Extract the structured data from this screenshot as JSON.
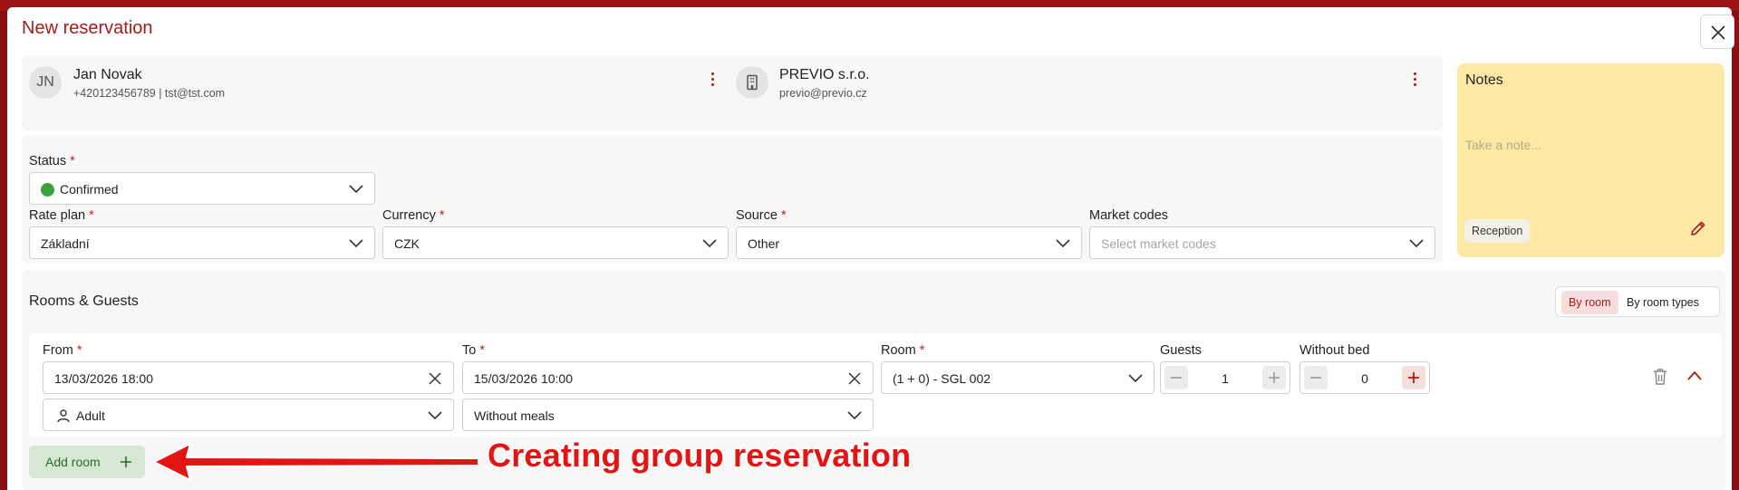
{
  "dialog": {
    "title": "New reservation"
  },
  "guest": {
    "initials": "JN",
    "name": "Jan Novak",
    "contact": "+420123456789 | tst@tst.com"
  },
  "company": {
    "name": "PREVIO s.r.o.",
    "email": "previo@previo.cz"
  },
  "form": {
    "status": {
      "label": "Status",
      "value": "Confirmed",
      "status_color": "#3aa43a"
    },
    "rate_plan": {
      "label": "Rate plan",
      "value": "Základní"
    },
    "currency": {
      "label": "Currency",
      "value": "CZK"
    },
    "source": {
      "label": "Source",
      "value": "Other"
    },
    "market_codes": {
      "label": "Market codes",
      "placeholder": "Select market codes"
    },
    "required_mark": "*"
  },
  "notes": {
    "title": "Notes",
    "placeholder": "Take a note...",
    "tag": "Reception"
  },
  "rooms": {
    "title": "Rooms & Guests",
    "view_toggle": [
      "By room",
      "By room types"
    ],
    "active_view": "By room",
    "row": {
      "from_label": "From",
      "from_value": "13/03/2026 18:00",
      "to_label": "To",
      "to_value": "15/03/2026 10:00",
      "room_label": "Room",
      "room_value": "(1 + 0) - SGL 002",
      "guests_label": "Guests",
      "guests_value": "1",
      "without_bed_label": "Without bed",
      "without_bed_value": "0",
      "guest_type": "Adult",
      "meal_plan": "Without meals"
    },
    "add_room_label": "Add room"
  },
  "annotation": {
    "text": "Creating group reservation",
    "color": "#e21414"
  },
  "colors": {
    "brand": "#a61b1b",
    "notes_bg": "#fde8a5",
    "add_button_bg": "#d6e7d4"
  }
}
